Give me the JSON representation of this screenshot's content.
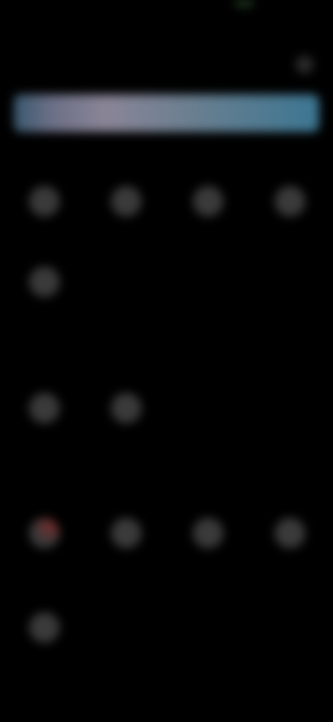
{
  "status_bar": {
    "time": ""
  },
  "header": {
    "title": "",
    "menu_icon": "more-icon"
  },
  "banner": {
    "text": "",
    "colors": [
      "#39586e",
      "#8a8597",
      "#3c7692"
    ]
  },
  "sections": [
    {
      "title": "",
      "items": [
        {
          "label": "",
          "icon": "tile-icon"
        },
        {
          "label": "",
          "icon": "tile-icon"
        },
        {
          "label": "",
          "icon": "tile-icon"
        },
        {
          "label": "",
          "icon": "tile-icon"
        },
        {
          "label": "",
          "icon": "tile-icon"
        }
      ]
    },
    {
      "title": "",
      "items": [
        {
          "label": "",
          "icon": "tile-icon"
        },
        {
          "label": "",
          "icon": "tile-icon"
        }
      ]
    },
    {
      "title": "",
      "items": [
        {
          "label": "",
          "icon": "tile-icon-badge"
        },
        {
          "label": "",
          "icon": "tile-icon"
        },
        {
          "label": "",
          "icon": "tile-icon"
        },
        {
          "label": "",
          "icon": "tile-icon"
        },
        {
          "label": "",
          "icon": "tile-icon"
        }
      ]
    }
  ],
  "theme": {
    "background": "#000000",
    "tile": "#3a3a3a",
    "badge_accent": "#7a2a2a"
  }
}
